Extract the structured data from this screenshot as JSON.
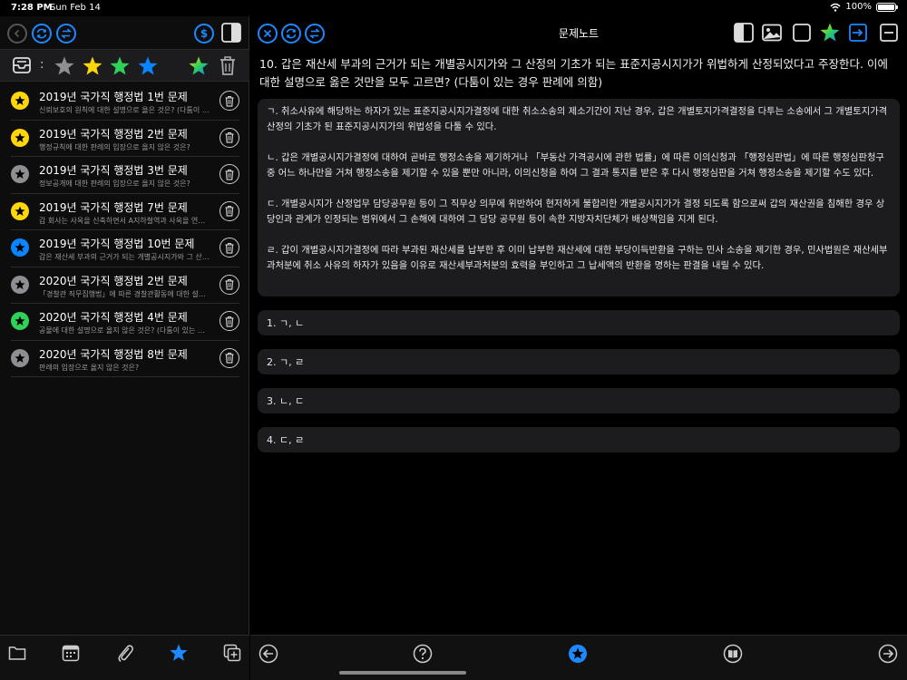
{
  "status": {
    "time": "7:28 PM",
    "date": "Sun Feb 14",
    "battery": "100%"
  },
  "right": {
    "nav_title": "문제노트",
    "question": "10. 갑은 재산세 부과의 근거가 되는 개별공시지가와 그 산정의 기초가 되는 표준지공시지가가 위법하게 산정되었다고 주장한다. 이에 대한 설명으로 옳은 것만을 모두 고르면? (다툼이 있는 경우 판례에 의함)",
    "passages": [
      "ㄱ. 취소사유에 해당하는 하자가 있는 표준지공시지가결정에 대한 취소소송의 제소기간이 지난 경우, 갑은 개별토지가격결정을 다투는 소송에서 그 개별토지가격 산정의 기초가 된 표준지공시지가의 위법성을 다툴 수 있다.",
      "ㄴ. 갑은 개별공시지가결정에 대하여 곧바로 행정소송을 제기하거나 「부동산 가격공시에 관한 법률」에 따른 이의신청과 「행정심판법」에 따른 행정심판청구 중 어느 하나만을 거쳐 행정소송을 제기할 수 있을 뿐만 아니라, 이의신청을 하여 그 결과 통지를 받은 후 다시 행정심판을 거쳐 행정소송을 제기할 수도 있다.",
      "ㄷ. 개별공시지가 산정업무 담당공무원 등이 그 직무상 의무에 위반하여 현저하게 불합리한 개별공시지가가 결정 되도록 함으로써 갑의 재산권을 침해한 경우 상당인과 관계가 인정되는 범위에서 그 손해에 대하여 그 담당 공무원 등이 속한 지방자치단체가 배상책임을 지게 된다.",
      "ㄹ. 갑이 개별공시지가결정에 따라 부과된 재산세를 납부한 후 이미 납부한 재산세에 대한 부당이득반환을 구하는 민사 소송을 제기한 경우, 민사법원은 재산세부과처분에 취소 사유의 하자가 있음을 이유로 재산세부과처분의 효력을 부인하고 그 납세액의 반환을 명하는 판결을 내릴 수 있다."
    ],
    "choices": [
      "1. ㄱ, ㄴ",
      "2. ㄱ, ㄹ",
      "3. ㄴ, ㄷ",
      "4. ㄷ, ㄹ"
    ]
  },
  "list": [
    {
      "title": "2019년 국가직 행정법 1번 문제",
      "sub": "신뢰보호의 원칙에 대한 설명으로 옳은 것은? (다툼이 있는 경우 판례에 의함)",
      "star": "yellow"
    },
    {
      "title": "2019년 국가직 행정법 2번 문제",
      "sub": "행정규칙에 대한 판례의 입장으로 옳지 않은 것은?",
      "star": "yellow"
    },
    {
      "title": "2019년 국가직 행정법 3번 문제",
      "sub": "정보공개에 대한 판례의 입장으로 옳지 않은 것은?",
      "star": "gray"
    },
    {
      "title": "2019년 국가직 행정법 7번 문제",
      "sub": "갑 회사는 사옥을 신축하면서 A지하철역과 사옥을 연결하는 지하연결통로를 설치하고자 한다.",
      "star": "yellow"
    },
    {
      "title": "2019년 국가직 행정법 10번 문제",
      "sub": "갑은 재산세 부과의 근거가 되는 개별공시지가와 그 산정의 기초가 되는 표준지공시지가가",
      "star": "blue"
    },
    {
      "title": "2020년 국가직 행정법 2번 문제",
      "sub": "「경찰관 직무집행법」에 따른 경찰관활동에 대한 설명으로 옳지 않은 것은?",
      "star": "gray"
    },
    {
      "title": "2020년 국가직 행정법 4번 문제",
      "sub": "공물에 대한 설명으로 옳지 않은 것은? (다툼이 있는 경우 판례에 의함)",
      "star": "green"
    },
    {
      "title": "2020년 국가직 행정법 8번 문제",
      "sub": "판례의 입장으로 옳지 않은 것은?",
      "star": "gray"
    }
  ],
  "colors": {
    "accent": "#1e88ff",
    "star_gray": "#8e8e93",
    "star_yellow": "#ffd60a",
    "star_green": "#30d158",
    "star_blue": "#0a84ff"
  },
  "icons": {
    "left_toolbar": [
      "back-icon",
      "refresh-icon",
      "swap-icon",
      "dollar-icon",
      "sidebar-toggle-icon"
    ],
    "filter": [
      "inbox-icon",
      "star-gray-icon",
      "star-yellow-icon",
      "star-green-icon",
      "star-blue-icon",
      "star-rainbow-icon",
      "trash-icon"
    ],
    "right_toolbar": [
      "close-icon",
      "refresh-icon",
      "swap-icon",
      "split-view-icon",
      "image-icon",
      "square-icon",
      "star-rainbow-icon",
      "enter-icon",
      "minus-icon"
    ],
    "left_tabbar": [
      "folder-icon",
      "calendar-icon",
      "paperclip-icon",
      "star-icon",
      "add-copy-icon"
    ],
    "right_tabbar": [
      "prev-icon",
      "help-icon",
      "star-badge-icon",
      "book-icon",
      "next-icon"
    ]
  },
  "filter": {
    "colon": ":"
  }
}
